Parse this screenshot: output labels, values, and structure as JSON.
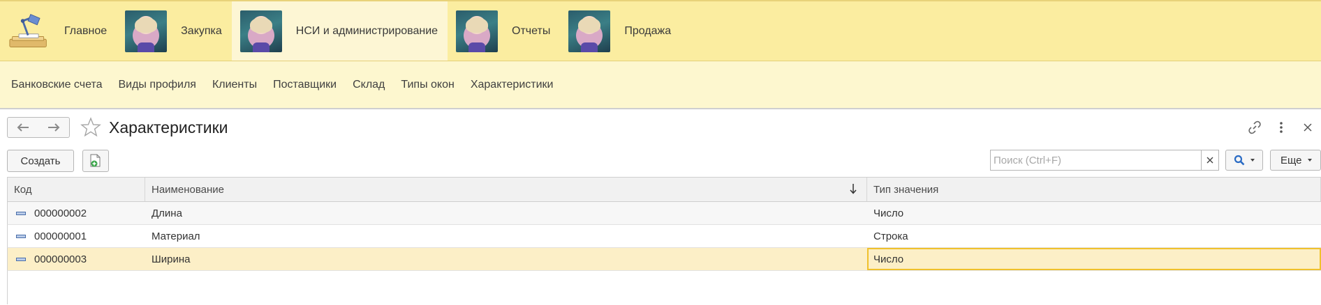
{
  "sections": [
    {
      "label": "Главное",
      "icon": "desk-lamp-icon"
    },
    {
      "label": "Закупка",
      "icon": "avatar-image"
    },
    {
      "label": "НСИ и администрирование",
      "icon": "avatar-image",
      "active": true
    },
    {
      "label": "Отчеты",
      "icon": "avatar-image"
    },
    {
      "label": "Продажа",
      "icon": "avatar-image"
    }
  ],
  "subnav": [
    "Банковские счета",
    "Виды профиля",
    "Клиенты",
    "Поставщики",
    "Склад",
    "Типы окон",
    "Характеристики"
  ],
  "form": {
    "title": "Характеристики",
    "create_label": "Создать",
    "search_placeholder": "Поиск (Ctrl+F)",
    "more_label": "Еще"
  },
  "table": {
    "columns": [
      "Код",
      "Наименование",
      "Тип значения"
    ],
    "sort_column": "Наименование",
    "rows": [
      {
        "code": "000000002",
        "name": "Длина",
        "type": "Число"
      },
      {
        "code": "000000001",
        "name": "Материал",
        "type": "Строка"
      },
      {
        "code": "000000003",
        "name": "Ширина",
        "type": "Число",
        "selected": true
      }
    ]
  },
  "colors": {
    "sections_bg": "#fbeda0",
    "active_section_bg": "#fdf6d4",
    "subnav_bg": "#fdf7cf",
    "selected_row_bg": "#fcefc7",
    "focus_border": "#f0c12c",
    "search_accent": "#2a6bc4"
  }
}
